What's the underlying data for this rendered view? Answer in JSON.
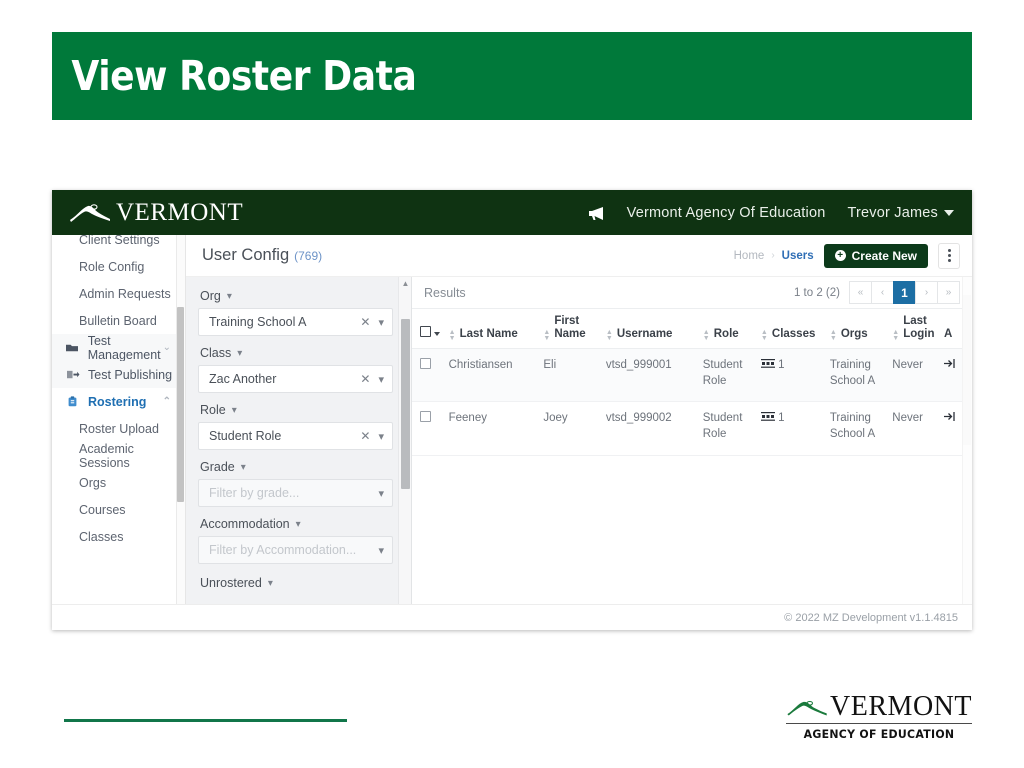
{
  "slide": {
    "title": "View Roster Data",
    "title_bg": "#00793a",
    "rule_color": "#11764a",
    "logo": {
      "word": "VERMONT",
      "subtitle": "AGENCY OF EDUCATION",
      "mark_color": "#1a7a3c"
    }
  },
  "app": {
    "topbar": {
      "brand": "VERMONT",
      "megaphone_icon": "megaphone-icon",
      "org": "Vermont Agency Of Education",
      "user": "Trevor James",
      "user_caret_icon": "chevron-down-icon",
      "bg": "#0f3312"
    },
    "sidebar": {
      "items": [
        {
          "label": "Client Settings",
          "type": "sub",
          "active": false,
          "icon": "",
          "chevron": ""
        },
        {
          "label": "Role Config",
          "type": "sub",
          "active": false,
          "icon": "",
          "chevron": ""
        },
        {
          "label": "Admin Requests",
          "type": "sub",
          "active": false,
          "icon": "",
          "chevron": ""
        },
        {
          "label": "Bulletin Board",
          "type": "sub",
          "active": false,
          "icon": "",
          "chevron": ""
        },
        {
          "label": "Test Management",
          "type": "group",
          "active": false,
          "icon": "folder-icon",
          "chevron": "⌄"
        },
        {
          "label": "Test Publishing",
          "type": "group",
          "active": false,
          "icon": "publish-icon",
          "chevron": "⌄"
        },
        {
          "label": "Rostering",
          "type": "group",
          "active": true,
          "icon": "clipboard-icon",
          "chevron": "⌃"
        },
        {
          "label": "Roster Upload",
          "type": "sub",
          "active": false,
          "icon": "",
          "chevron": ""
        },
        {
          "label": "Academic Sessions",
          "type": "sub",
          "active": false,
          "icon": "",
          "chevron": ""
        },
        {
          "label": "Orgs",
          "type": "sub",
          "active": false,
          "icon": "",
          "chevron": ""
        },
        {
          "label": "Courses",
          "type": "sub",
          "active": false,
          "icon": "",
          "chevron": ""
        },
        {
          "label": "Classes",
          "type": "sub",
          "active": false,
          "icon": "",
          "chevron": ""
        }
      ],
      "active_color": "#1f6fb2"
    },
    "content_header": {
      "title": "User Config",
      "count": "(769)",
      "breadcrumb_home": "Home",
      "breadcrumb_sep": "›",
      "breadcrumb_current": "Users",
      "create_button": "Create New",
      "create_icon": "plus-circle-icon",
      "kebab_icon": "vertical-dots-icon"
    },
    "filters": {
      "fields": [
        {
          "label": "Org",
          "value": "Training School A",
          "placeholder": "",
          "clearable": true
        },
        {
          "label": "Class",
          "value": "Zac Another",
          "placeholder": "",
          "clearable": true
        },
        {
          "label": "Role",
          "value": "Student Role",
          "placeholder": "",
          "clearable": true
        },
        {
          "label": "Grade",
          "value": "",
          "placeholder": "Filter by grade...",
          "clearable": false
        },
        {
          "label": "Accommodation",
          "value": "",
          "placeholder": "Filter by Accommodation...",
          "clearable": false
        }
      ],
      "trailing_label": "Unrostered",
      "clear_icon": "clear-x-icon",
      "caret_icon": "chevron-down-icon"
    },
    "results": {
      "title": "Results",
      "range": "1 to 2 (2)",
      "pager": [
        {
          "label": "«",
          "name": "first-page",
          "active": false
        },
        {
          "label": "‹",
          "name": "prev-page",
          "active": false
        },
        {
          "label": "1",
          "name": "page-1",
          "active": true
        },
        {
          "label": "›",
          "name": "next-page",
          "active": false
        },
        {
          "label": "»",
          "name": "last-page",
          "active": false
        }
      ],
      "active_page_color": "#1c6ea4",
      "columns": [
        "Last Name",
        "First Name",
        "Username",
        "Role",
        "Classes",
        "Orgs",
        "Last Login",
        "A"
      ],
      "rows": [
        {
          "last_name": "Christiansen",
          "first_name": "Eli",
          "username": "vtsd_999001",
          "role": "Student Role",
          "classes_icon": "class-group-icon",
          "classes": "1",
          "orgs": "Training School A",
          "last_login": "Never",
          "action_icon": "login-arrow-icon"
        },
        {
          "last_name": "Feeney",
          "first_name": "Joey",
          "username": "vtsd_999002",
          "role": "Student Role",
          "classes_icon": "class-group-icon",
          "classes": "1",
          "orgs": "Training School A",
          "last_login": "Never",
          "action_icon": "login-arrow-icon"
        }
      ]
    },
    "footer": "© 2022 MZ Development v1.1.4815"
  }
}
